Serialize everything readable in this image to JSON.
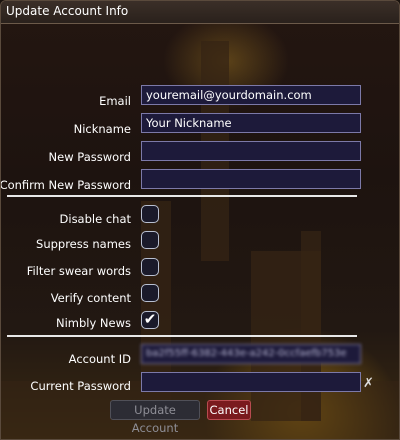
{
  "window": {
    "title": "Update Account Info"
  },
  "form": {
    "email": {
      "label": "Email",
      "value": "youremail@yourdomain.com"
    },
    "nickname": {
      "label": "Nickname",
      "value": "Your Nickname"
    },
    "new_password": {
      "label": "New Password",
      "value": ""
    },
    "confirm_password": {
      "label": "Confirm New Password",
      "value": ""
    }
  },
  "options": [
    {
      "label": "Disable chat",
      "checked": false
    },
    {
      "label": "Suppress names",
      "checked": false
    },
    {
      "label": "Filter swear words",
      "checked": false
    },
    {
      "label": "Verify content",
      "checked": false
    },
    {
      "label": "Nimbly News",
      "checked": true
    }
  ],
  "account": {
    "id_label": "Account ID",
    "id_value": "ba2f55ff-6382-443e-a242-0ccfaefb753e",
    "current_password_label": "Current Password",
    "current_password_value": ""
  },
  "buttons": {
    "update": "Update Account",
    "cancel": "Cancel"
  },
  "glyphs": {
    "checkmark": "✔",
    "clear": "✗"
  }
}
